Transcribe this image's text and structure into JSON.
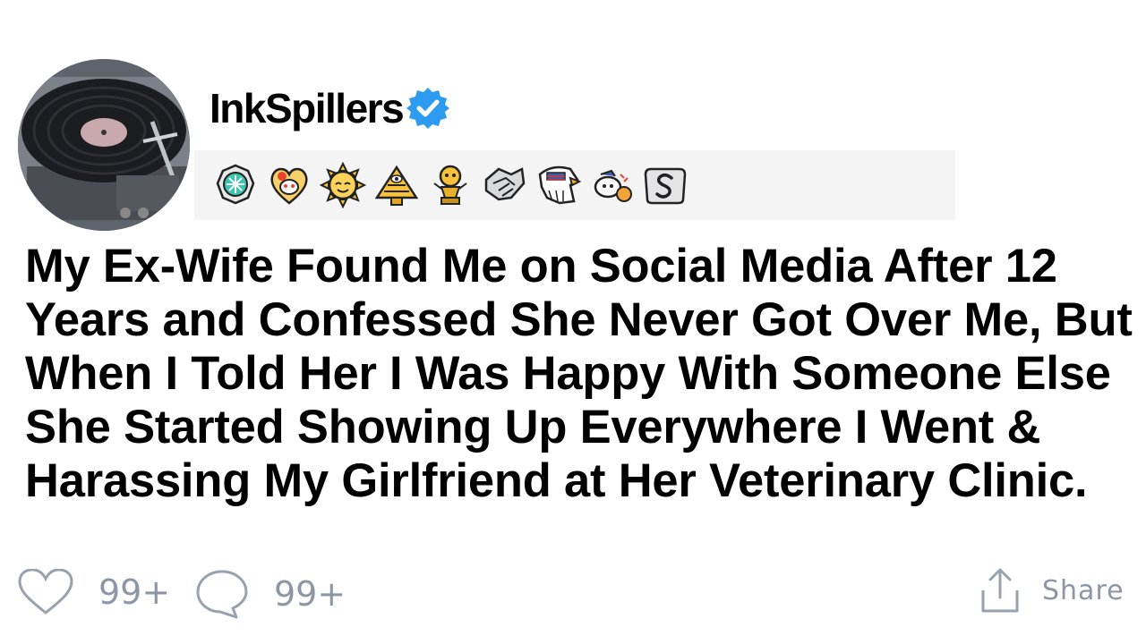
{
  "author": {
    "username": "InkSpillers",
    "verified": true,
    "avatar_icon": "vinyl-record-player-icon"
  },
  "awards": [
    {
      "icon": "gear-award-icon"
    },
    {
      "icon": "heart-snoo-award-icon"
    },
    {
      "icon": "sun-award-icon"
    },
    {
      "icon": "pyramid-eye-award-icon"
    },
    {
      "icon": "gold-trophy-award-icon"
    },
    {
      "icon": "handshake-award-icon"
    },
    {
      "icon": "eagle-award-icon"
    },
    {
      "icon": "snoo-award-icon"
    },
    {
      "icon": "silver-s-award-icon"
    }
  ],
  "post": {
    "title": "My Ex-Wife Found Me on Social Media After 12 Years and Confessed She Never Got Over Me, But When I Told Her I Was Happy With Someone Else She Started Showing Up Everywhere I Went & Harassing My Girlfriend at Her Veterinary Clinic."
  },
  "actions": {
    "likes": "99+",
    "comments": "99+",
    "share_label": "Share"
  },
  "colors": {
    "verified_blue": "#2d9cf0",
    "muted_gray": "#8e96a6",
    "awards_bg": "#f4f4f4"
  }
}
